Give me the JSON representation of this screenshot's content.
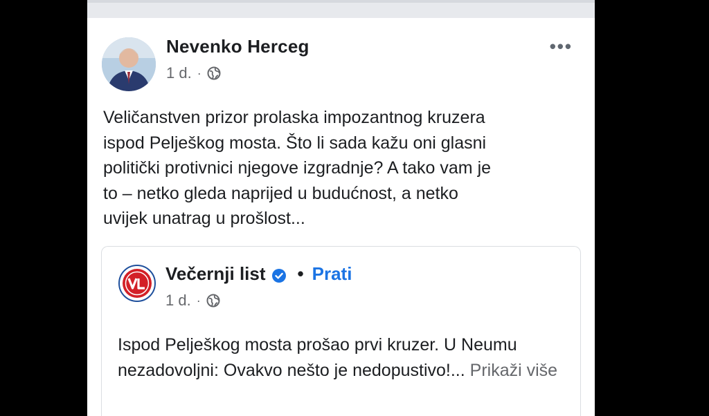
{
  "post": {
    "author": "Nevenko Herceg",
    "time": "1 d.",
    "separator": "·",
    "more": "•••",
    "text": "Veličanstven prizor prolaska impozantnog kruzera\nispod Pelješkog mosta. Što li sada kažu oni glasni\npolitički protivnici njegove izgradnje? A tako vam je\nto – netko gleda naprijed u budućnost, a netko\nuvijek unatrag u prošlost..."
  },
  "shared": {
    "page_name": "Večernji list",
    "logo_text": "VL",
    "dot": "•",
    "follow": "Prati",
    "time": "1 d.",
    "separator": "·",
    "text": "Ispod Pelješkog mosta prošao prvi kruzer. U Neumu nezadovoljni: Ovakvo nešto je nedopustivo!...",
    "see_more": "Prikaži više"
  },
  "colors": {
    "link": "#1b74e4",
    "logo_red": "#d32027",
    "verified": "#1b74e4"
  }
}
